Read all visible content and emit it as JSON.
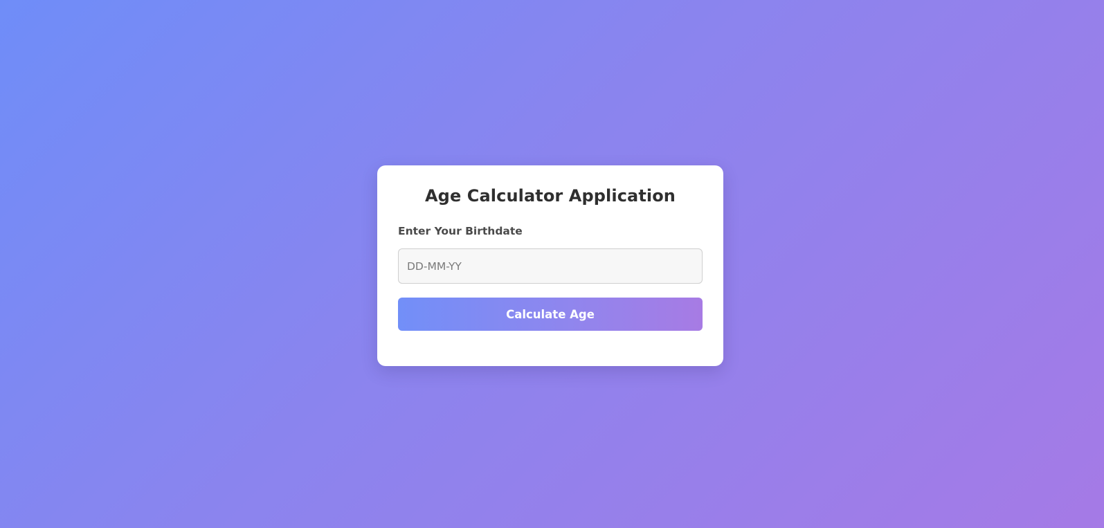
{
  "app": {
    "title": "Age Calculator Application"
  },
  "form": {
    "birthdate_label": "Enter Your Birthdate",
    "birthdate_value": "",
    "birthdate_placeholder": "DD-MM-YY",
    "submit_label": "Calculate Age"
  },
  "colors": {
    "background_start": "#6f8df8",
    "background_end": "#a57ae6",
    "button_start": "#728ff8",
    "button_end": "#a77be4",
    "card": "#ffffff"
  }
}
